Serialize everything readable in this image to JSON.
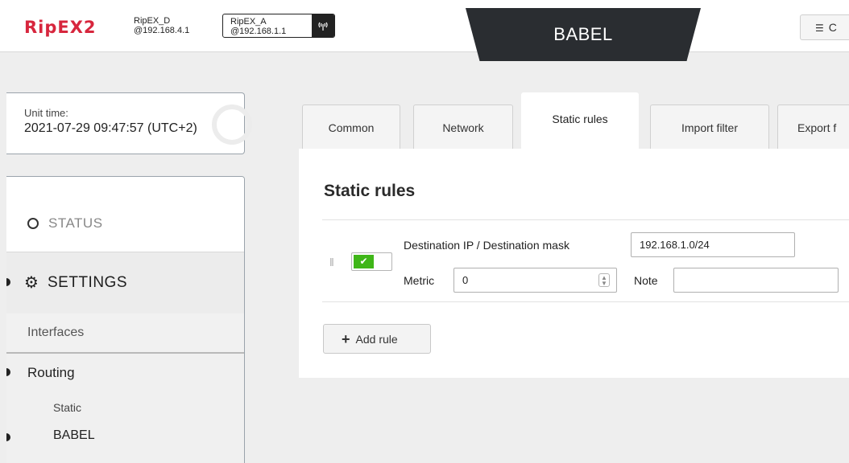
{
  "header": {
    "logo_text": "RipEX2",
    "local_unit": {
      "name": "RipEX_D",
      "ip": "@192.168.4.1"
    },
    "remote_unit": {
      "name": "RipEX_A",
      "ip": "@192.168.1.1"
    },
    "page_title": "BABEL",
    "menu_button_label": "C",
    "menu_icon": "list-icon",
    "antenna_icon": "antenna-icon"
  },
  "unit_time": {
    "label": "Unit time:",
    "value": "2021-07-29 09:47:57 (UTC+2)"
  },
  "sidebar": {
    "status_label": "STATUS",
    "settings_label": "SETTINGS",
    "items": [
      {
        "label": "Interfaces"
      },
      {
        "label": "Routing"
      }
    ],
    "routing_sub": [
      {
        "label": "Static"
      },
      {
        "label": "BABEL"
      }
    ]
  },
  "tabs": [
    {
      "label": "Common"
    },
    {
      "label": "Network"
    },
    {
      "label": "Static rules",
      "active": true
    },
    {
      "label": "Import filter"
    },
    {
      "label": "Export f"
    }
  ],
  "main": {
    "section_title": "Static rules",
    "rule": {
      "enabled": true,
      "dest_label": "Destination IP / Destination mask",
      "dest_value": "192.168.1.0/24",
      "metric_label": "Metric",
      "metric_value": "0",
      "note_label": "Note",
      "note_value": ""
    },
    "add_rule_label": "Add rule"
  },
  "colors": {
    "brand_red": "#d7263d",
    "banner_dark": "#2a2d31",
    "toggle_green": "#3fb618"
  }
}
